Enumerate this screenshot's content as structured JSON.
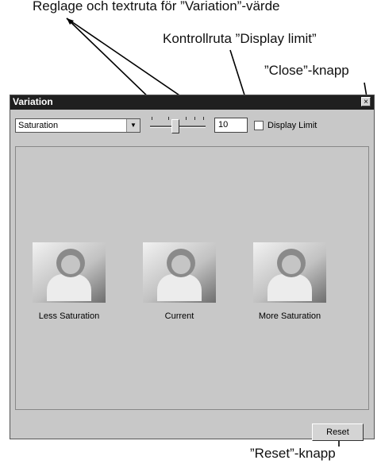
{
  "callouts": {
    "slider_and_textbox": "Reglage och textruta för ”Variation”-värde",
    "display_limit": "Kontrollruta ”Display limit”",
    "close": "”Close”-knapp",
    "reset": "”Reset”-knapp"
  },
  "window": {
    "title": "Variation",
    "close_glyph": "×"
  },
  "controls": {
    "dropdown_value": "Saturation",
    "slider_level_fraction": 0.46,
    "variation_value": "10",
    "display_limit_label": "Display Limit",
    "display_limit_checked": false
  },
  "thumbnails": [
    {
      "caption": "Less Saturation"
    },
    {
      "caption": "Current"
    },
    {
      "caption": "More Saturation"
    }
  ],
  "buttons": {
    "reset_label": "Reset"
  }
}
